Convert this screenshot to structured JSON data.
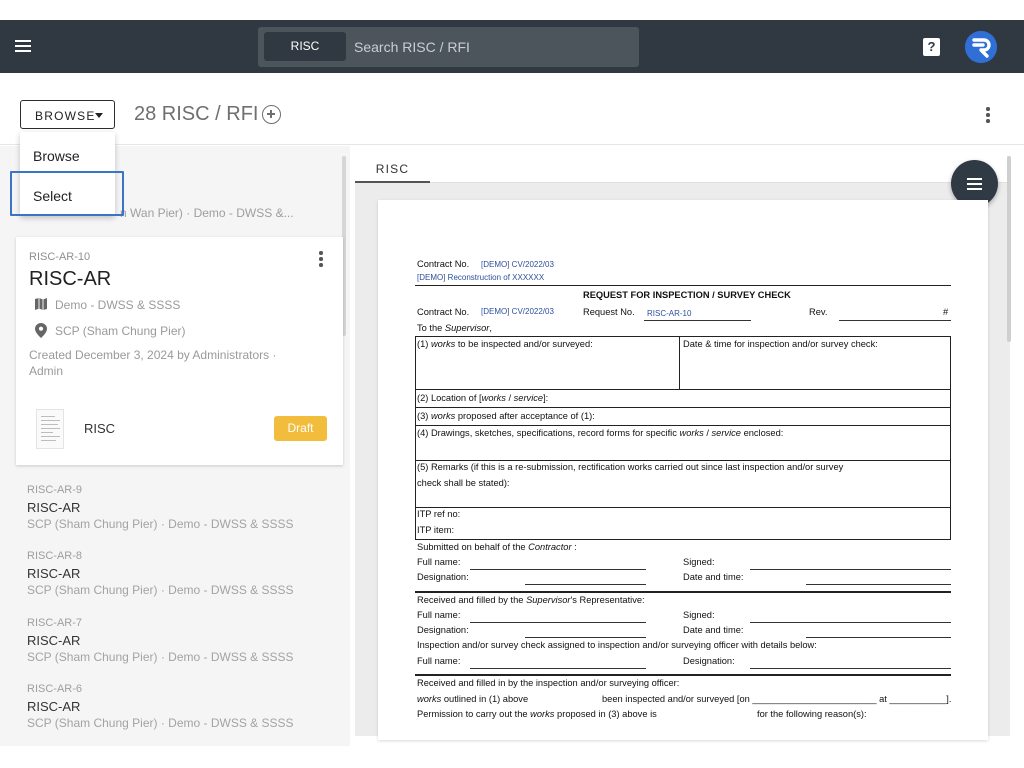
{
  "appbar": {
    "search_type": "RISC",
    "search_placeholder": "Search RISC / RFI",
    "help_icon_glyph": "?"
  },
  "toolbar": {
    "browse_label": "BROWSE",
    "count_label": "28 RISC / RFI"
  },
  "dropdown": {
    "items": [
      "Browse",
      "Select"
    ],
    "highlight_color": "#3a74c7"
  },
  "list": {
    "partial_row_sub": "n Wan Pier) · Demo - DWSS &...",
    "selected_card": {
      "code": "RISC-AR-10",
      "title": "RISC-AR",
      "project": "Demo - DWSS & SSSS",
      "location": "SCP (Sham Chung Pier)",
      "created": "Created December 3, 2024 by Administrators · Admin",
      "attachment_label": "RISC",
      "status": "Draft",
      "status_color": "#f2bd3c"
    },
    "rows": [
      {
        "code": "RISC-AR-9",
        "title": "RISC-AR",
        "sub": "SCP (Sham Chung Pier) · Demo - DWSS & SSSS"
      },
      {
        "code": "RISC-AR-8",
        "title": "RISC-AR",
        "sub": "SCP (Sham Chung Pier) · Demo - DWSS & SSSS"
      },
      {
        "code": "RISC-AR-7",
        "title": "RISC-AR",
        "sub": "SCP (Sham Chung Pier) · Demo - DWSS & SSSS"
      },
      {
        "code": "RISC-AR-6",
        "title": "RISC-AR",
        "sub": "SCP (Sham Chung Pier) · Demo - DWSS & SSSS"
      }
    ]
  },
  "viewer": {
    "tab_label": "RISC",
    "doc": {
      "contract_label": "Contract No.",
      "contract_value": "[DEMO] CV/2022/03",
      "project_name": "[DEMO] Reconstruction of XXXXXX",
      "heading": "REQUEST FOR INSPECTION / SURVEY CHECK",
      "request_label": "Request No.",
      "request_value": "RISC-AR-10",
      "rev_label": "Rev.",
      "hash": "#",
      "to_label": "To the",
      "to_italic": "Supervisor",
      "to_comma": ",",
      "box1_prefix": "(1)",
      "box1_italic": "works",
      "box1_rest": "to be inspected and/or surveyed:",
      "box1_right": "Date & time for inspection and/or survey check:",
      "box2_prefix": "(2) Location of [",
      "box2_italic1": "works",
      "box2_sep": " / ",
      "box2_italic2": "service",
      "box2_suffix": "]:",
      "box3_prefix": "(3)",
      "box3_italic": "works",
      "box3_rest": "proposed after acceptance of (1):",
      "box4_prefix": "(4) Drawings, sketches, specifications, record forms for specific",
      "box4_italic1": "works",
      "box4_sep": " / ",
      "box4_italic2": "service",
      "box4_rest": "enclosed:",
      "box5_line1": "(5) Remarks (if this is a re-submission, rectification works carried out since last inspection and/or survey",
      "box5_line2": "check shall be stated):",
      "itp_ref": "ITP ref no:",
      "itp_item": "ITP item:",
      "submitted_prefix": "Submitted on behalf of the",
      "submitted_italic": "Contractor",
      "submitted_suffix": ":",
      "full_name": "Full name:",
      "designation": "Designation:",
      "signed": "Signed:",
      "date_time": "Date and time:",
      "received_prefix": "Received and filled by the",
      "received_italic": "Supervisor",
      "received_suffix": "'s Representative:",
      "assigned_line": "Inspection and/or survey check assigned to inspection and/or surveying officer with details below:",
      "received_officer": "Received and filled in by the inspection and/or surveying officer:",
      "outlined_italic": "works",
      "outlined_rest": "outlined in (1) above",
      "been_inspected": "been inspected and/or surveyed [on ________________________  at ___________].",
      "permission_prefix": "Permission to carry out the",
      "permission_italic": "works",
      "permission_rest": "proposed in (3) above is",
      "permission_reason": "for the following reason(s):"
    }
  }
}
